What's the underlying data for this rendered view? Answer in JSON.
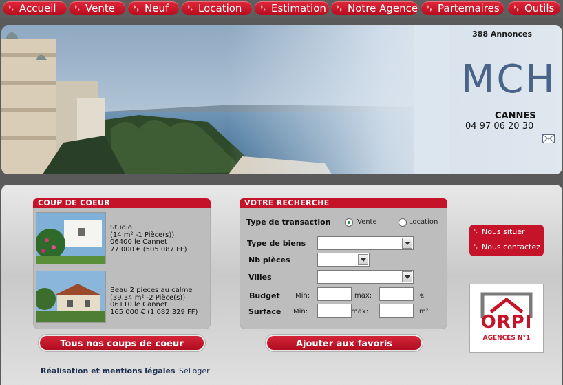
{
  "nav": {
    "items": [
      {
        "label": "Accueil"
      },
      {
        "label": "Vente"
      },
      {
        "label": "Neuf"
      },
      {
        "label": "Location"
      },
      {
        "label": "Estimation"
      },
      {
        "label": "Notre Agence"
      },
      {
        "label": "Partemaires"
      },
      {
        "label": "Outils"
      }
    ]
  },
  "header": {
    "annonces": "388 Annonces",
    "brand": "MCH",
    "city": "CANNES",
    "phone": "04 97 06 20 30"
  },
  "coup_de_coeur": {
    "title": "COUP DE COEUR",
    "properties": [
      {
        "line1": "Studio",
        "line2": "(14 m² -1 Pièce(s))",
        "line3": "06400 le Cannet",
        "line4": "77 000 € (505 087 FF)"
      },
      {
        "line1": "Beau 2 pièces au calme",
        "line2": "(39,34 m² -2 Pièce(s))",
        "line3": "06110 le Cannet",
        "line4": "165 000 € (1 082 329 FF)"
      }
    ],
    "button": "Tous nos coups de coeur"
  },
  "recherche": {
    "title": "VOTRE RECHERCHE",
    "type_transaction": "Type de transaction",
    "opt_vente": "Vente",
    "opt_location": "Location",
    "type_biens": "Type de biens",
    "nb_pieces": "Nb pièces",
    "villes": "Villes",
    "budget": "Budget",
    "surface": "Surface",
    "min": "Min:",
    "max": "max:",
    "max2": "max:",
    "unit_euro": "€",
    "unit_m2": "m²",
    "button": "Ajouter aux favoris"
  },
  "side": {
    "nous_situer": "Nous situer",
    "nous_contactez": "Nous contactez"
  },
  "orpi": {
    "name": "ORPI",
    "tagline": "AGENCES N°1"
  },
  "footer": {
    "credits": "Réalisation et mentions légales",
    "seloger": "SeLoger"
  },
  "colors": {
    "accent": "#c5142a",
    "brand_blue": "#4a6388"
  }
}
